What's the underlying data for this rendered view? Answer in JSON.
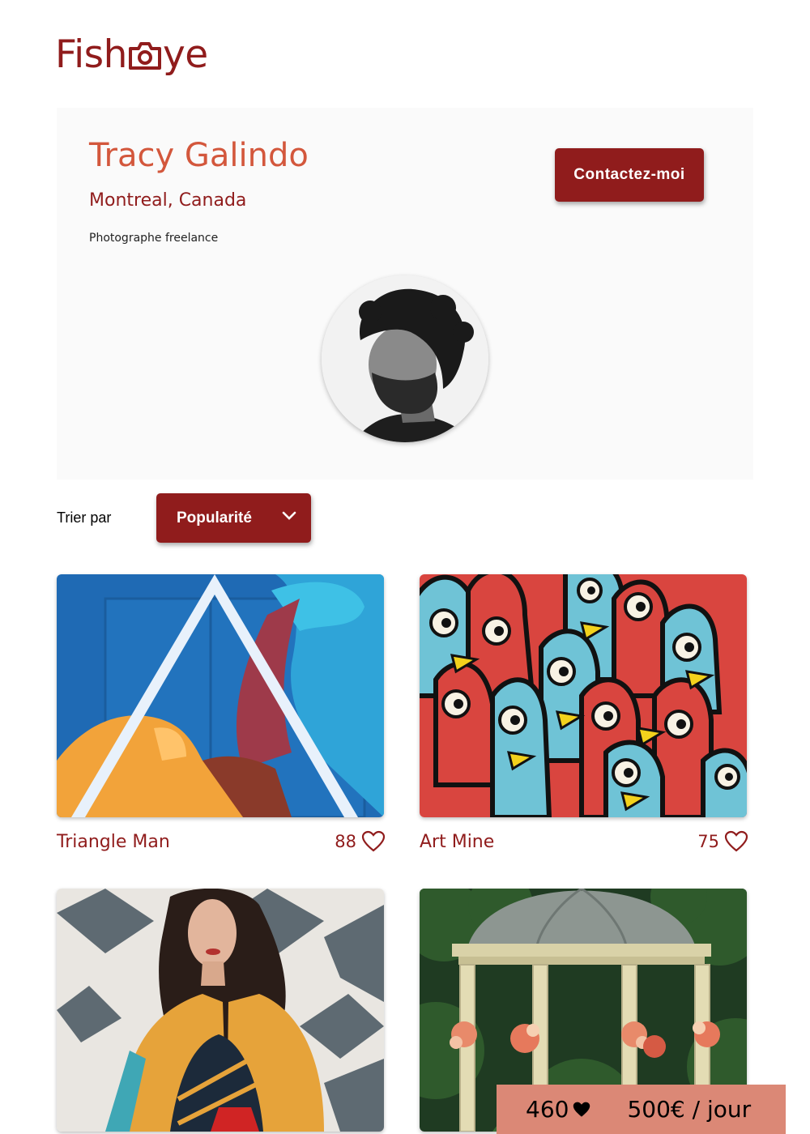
{
  "header": {
    "logo_left": "Fish",
    "logo_right": "ye",
    "logo_icon": "camera-icon"
  },
  "photographer": {
    "name": "Tracy Galindo",
    "location": "Montreal, Canada",
    "tagline": "Photographe freelance",
    "contact_label": "Contactez-moi"
  },
  "sort": {
    "label": "Trier par",
    "selected": "Popularité"
  },
  "gallery": [
    {
      "title": "Triangle Man",
      "likes": "88"
    },
    {
      "title": "Art Mine",
      "likes": "75"
    },
    {
      "title": "",
      "likes": ""
    },
    {
      "title": "",
      "likes": ""
    }
  ],
  "footer": {
    "total_likes": "460",
    "price": "500€ / jour"
  },
  "colors": {
    "brand": "#901c1c",
    "accent": "#d3573c",
    "footer_bg": "#db8876",
    "panel_bg": "#fafafa"
  }
}
